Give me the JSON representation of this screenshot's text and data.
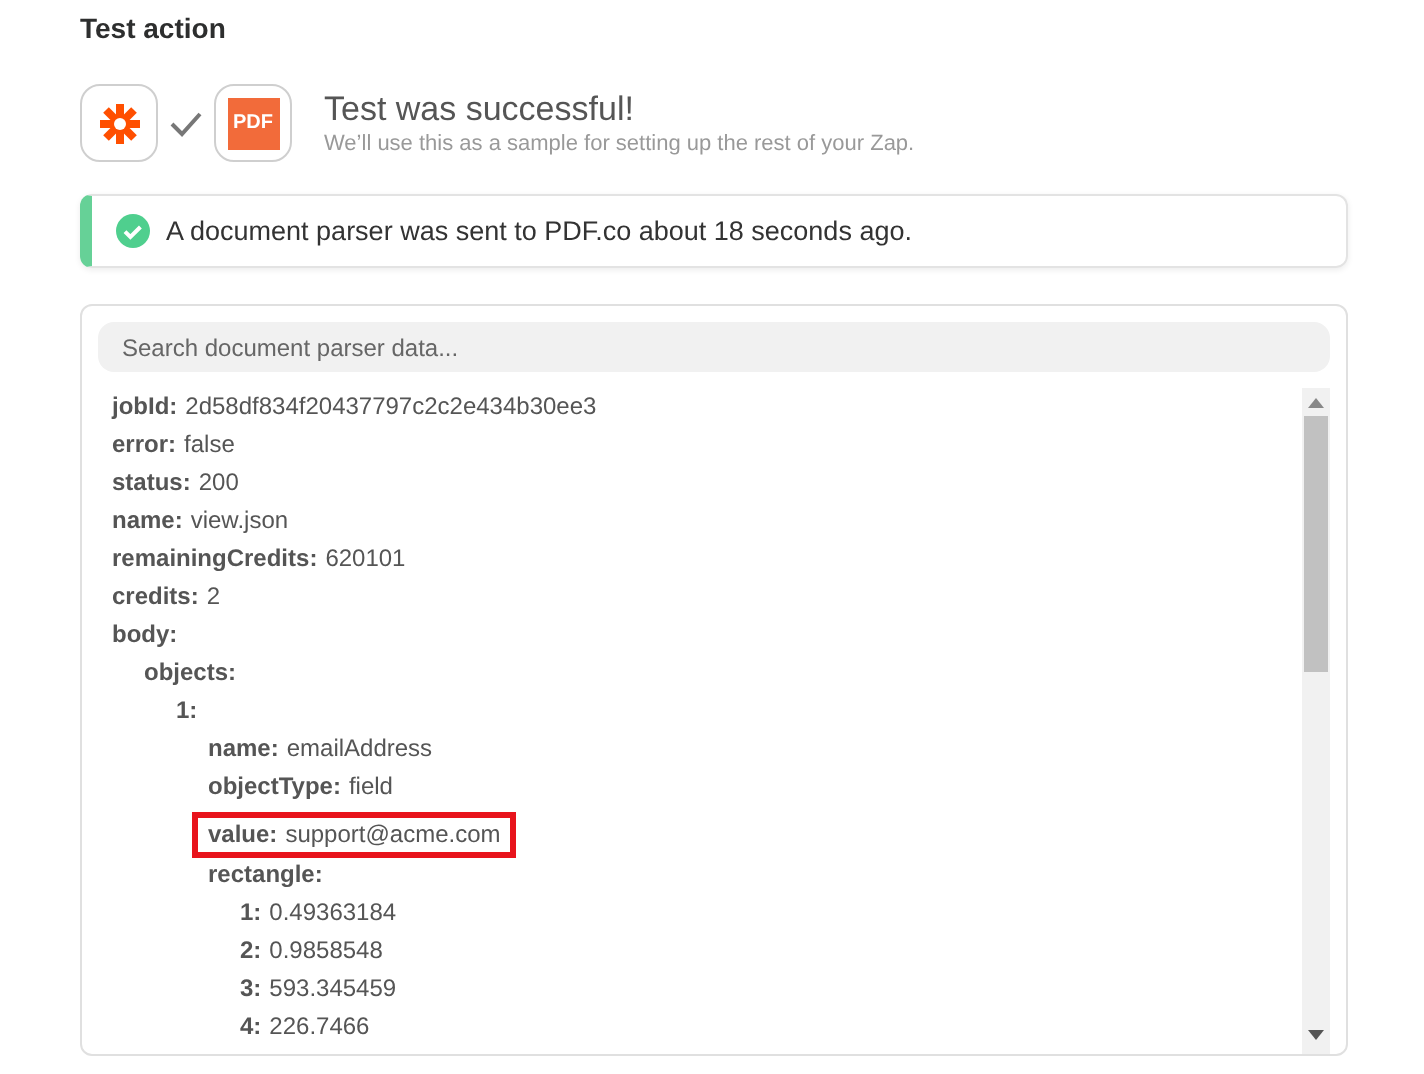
{
  "heading": "Test action",
  "result": {
    "title": "Test was successful!",
    "subtitle": "We’ll use this as a sample for setting up the rest of your Zap.",
    "app_label": "PDF"
  },
  "alert": {
    "message": "A document parser was sent to PDF.co about 18 seconds ago."
  },
  "search": {
    "placeholder": "Search document parser data..."
  },
  "tree": [
    {
      "key": "jobId:",
      "value": "2d58df834f20437797c2c2e434b30ee3"
    },
    {
      "key": "error:",
      "value": "false"
    },
    {
      "key": "status:",
      "value": "200"
    },
    {
      "key": "name:",
      "value": "view.json"
    },
    {
      "key": "remainingCredits:",
      "value": "620101"
    },
    {
      "key": "credits:",
      "value": "2"
    },
    {
      "key": "body:",
      "children": [
        {
          "key": "objects:",
          "children": [
            {
              "key": "1:",
              "children": [
                {
                  "key": "name:",
                  "value": "emailAddress",
                  "highlighted": false
                },
                {
                  "key": "objectType:",
                  "value": "field",
                  "highlighted": false
                },
                {
                  "key": "value:",
                  "value": "support@acme.com",
                  "highlighted": true
                },
                {
                  "key": "rectangle:",
                  "highlighted": false,
                  "children": [
                    {
                      "key": "1:",
                      "value": "0.49363184"
                    },
                    {
                      "key": "2:",
                      "value": "0.9858548"
                    },
                    {
                      "key": "3:",
                      "value": "593.345459"
                    },
                    {
                      "key": "4:",
                      "value": "226.7466"
                    }
                  ]
                }
              ]
            }
          ]
        }
      ]
    }
  ]
}
